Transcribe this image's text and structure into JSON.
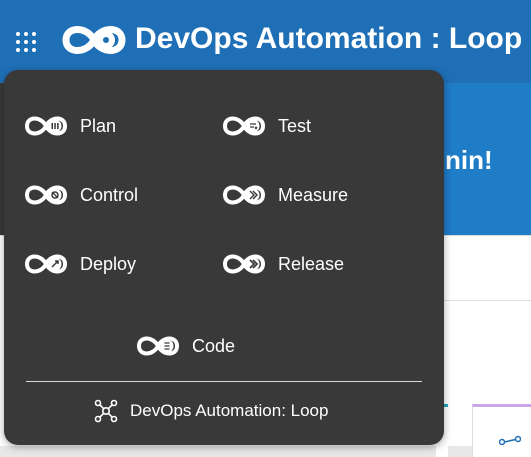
{
  "header": {
    "title": "DevOps Automation : Loop",
    "apps_icon": "grid-dots-icon",
    "logo_icon": "loop-logo-icon",
    "background_color": "#1f6fb6"
  },
  "banner": {
    "visible_text": "nin!",
    "background_color": "#1f7cc6"
  },
  "app_menu": {
    "items": [
      {
        "label": "Plan",
        "icon": "plan-icon"
      },
      {
        "label": "Test",
        "icon": "test-icon"
      },
      {
        "label": "Control",
        "icon": "control-icon"
      },
      {
        "label": "Measure",
        "icon": "measure-icon"
      },
      {
        "label": "Deploy",
        "icon": "deploy-icon"
      },
      {
        "label": "Release",
        "icon": "release-icon"
      },
      {
        "label": "Code",
        "icon": "code-icon"
      }
    ],
    "footer_link": {
      "label": "DevOps Automation: Loop",
      "icon": "network-hub-icon"
    },
    "background_color": "#393939"
  }
}
